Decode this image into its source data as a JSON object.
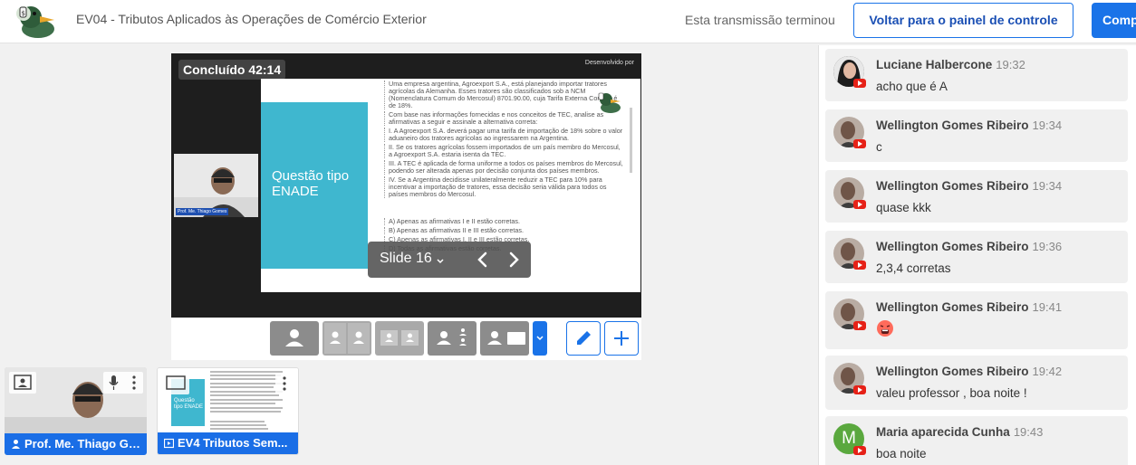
{
  "header": {
    "title": "EV04 - Tributos Aplicados às Operações de Comércio Exterior",
    "status": "Esta transmissão terminou",
    "back_button": "Voltar para o painel de controle",
    "partial_button": "Comp"
  },
  "player": {
    "badge": "Concluído 42:14",
    "dev_by": "Desenvolvido por",
    "cam_label": "Prof. Me. Thiago Gomes",
    "slide_label": "Slide 16",
    "slide": {
      "block_title": "Questão tipo ENADE",
      "paragraphs": [
        "Uma empresa argentina, Agroexport S.A., está planejando importar tratores agrícolas da Alemanha. Esses tratores são classificados sob a NCM (Nomenclatura Comum do Mercosul) 8701.90.00, cuja Tarifa Externa Comum é de 18%.",
        "Com base nas informações fornecidas e nos conceitos de TEC, analise as afirmativas a seguir e assinale a alternativa correta:",
        "I. A Agroexport S.A. deverá pagar uma tarifa de importação de 18% sobre o valor aduaneiro dos tratores agrícolas ao ingressarem na Argentina.",
        "II. Se os tratores agrícolas fossem importados de um país membro do Mercosul, a Agroexport S.A. estaria isenta da TEC.",
        "III. A TEC é aplicada de forma uniforme a todos os países membros do Mercosul, podendo ser alterada apenas por decisão conjunta dos países membros.",
        "IV. Se a Argentina decidisse unilateralmente reduzir a TEC para 10% para incentivar a importação de tratores, essa decisão seria válida para todos os países membros do Mercosul."
      ],
      "options": [
        "A) Apenas as afirmativas I e II estão corretas.",
        "B) Apenas as afirmativas II e III estão corretas.",
        "C) Apenas as afirmativas I, II e III estão corretas.",
        "D) Todas as afirmativas estão corretas."
      ]
    }
  },
  "thumbnails": [
    {
      "label": "Prof. Me. Thiago Gomes",
      "icon": "person-icon"
    },
    {
      "label": "EV4 Tributos Sem...",
      "icon": "presentation-icon",
      "slide_title": "Questão tipo ENADE"
    }
  ],
  "chat": {
    "messages": [
      {
        "name": "Luciane Halbercone",
        "time": "19:32",
        "text": "acho que é A",
        "avatar_color": "#2b2b2b"
      },
      {
        "name": "Wellington Gomes Ribeiro",
        "time": "19:34",
        "text": "c",
        "avatar_color": "#9a8a80"
      },
      {
        "name": "Wellington Gomes Ribeiro",
        "time": "19:34",
        "text": "quase kkk",
        "avatar_color": "#9a8a80"
      },
      {
        "name": "Wellington Gomes Ribeiro",
        "time": "19:36",
        "text": "2,3,4 corretas",
        "avatar_color": "#9a8a80"
      },
      {
        "name": "Wellington Gomes Ribeiro",
        "time": "19:41",
        "text": "",
        "emoji": "crying-face-emoji",
        "avatar_color": "#9a8a80"
      },
      {
        "name": "Wellington Gomes Ribeiro",
        "time": "19:42",
        "text": "valeu professor , boa noite !",
        "avatar_color": "#9a8a80"
      },
      {
        "name": "Maria aparecida Cunha",
        "time": "19:43",
        "text": "boa noite",
        "avatar_letter": "M",
        "avatar_color": "#5aa83e"
      }
    ]
  },
  "colors": {
    "accent": "#1a73e8",
    "slide_block": "#3fb7cf",
    "youtube_red": "#e62117"
  }
}
